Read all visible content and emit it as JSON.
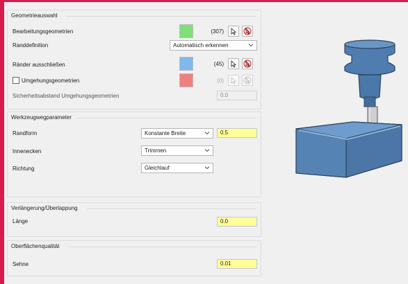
{
  "geometry": {
    "title": "Geometrieauswahl",
    "edit_label": "Bearbeitungsgeometrien",
    "edit_count": "(307)",
    "edit_color": "#7fe07a",
    "edge_label": "Randdefinition",
    "edge_value": "Automatisch erkennen",
    "exclude_label": "Ränder ausschließen",
    "exclude_count": "(45)",
    "exclude_color": "#80b8ef",
    "bypass_label": "Umgehungsgeometrien",
    "bypass_count": "(0)",
    "bypass_color": "#ef8080",
    "safety_label": "Sicherheitsabstand Umgehungsgeometrien",
    "safety_value": "0.0"
  },
  "toolpath": {
    "title": "Werkzeugwegparameter",
    "edge_form_label": "Randform",
    "edge_form_value": "Konstante Breite",
    "edge_form_number": "0.5",
    "inner_label": "Innenecken",
    "inner_value": "Trimmen",
    "direction_label": "Richtung",
    "direction_value": "Gleichlauf"
  },
  "extension": {
    "title": "Verlängerung/Überlappung",
    "length_label": "Länge",
    "length_value": "0.0"
  },
  "surface": {
    "title": "Oberflächenqualität",
    "chord_label": "Sehne",
    "chord_value": "0.01"
  },
  "icons": {
    "select": "cursor-arrow-icon",
    "deselect": "deselect-cursor-icon",
    "dropdown": "chevron-down-icon"
  }
}
